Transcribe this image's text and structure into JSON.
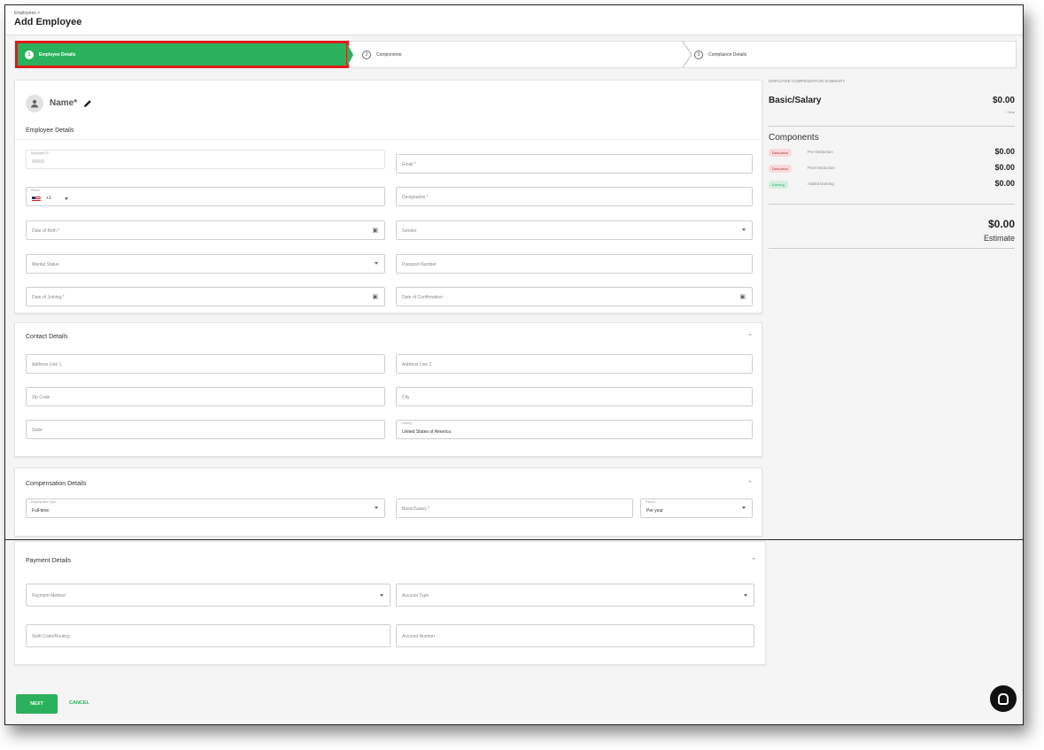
{
  "header": {
    "breadcrumb": "Employees >",
    "title": "Add Employee"
  },
  "stepper": {
    "steps": [
      {
        "number": "1",
        "label": "Employee Details"
      },
      {
        "number": "2",
        "label": "Components"
      },
      {
        "number": "3",
        "label": "Compliance Details"
      }
    ]
  },
  "employee": {
    "name_label": "Name*",
    "section_title": "Employee Details",
    "employee_id": {
      "label": "Employee ID",
      "value": "00000"
    },
    "email": {
      "placeholder": "Email *"
    },
    "phone": {
      "label": "Phone",
      "code": "+1"
    },
    "designation": {
      "placeholder": "Designation *"
    },
    "dob": {
      "placeholder": "Date of Birth *"
    },
    "gender": {
      "placeholder": "Gender"
    },
    "marital": {
      "placeholder": "Marital Status"
    },
    "passport": {
      "placeholder": "Passport Number"
    },
    "joining": {
      "placeholder": "Date of Joining *"
    },
    "confirmation": {
      "placeholder": "Date of Confirmation"
    }
  },
  "contact": {
    "title": "Contact Details",
    "address1": "Address Line 1",
    "address2": "Address Line 2",
    "zip": "Zip Code",
    "city": "City",
    "state": "State",
    "country_label": "Country",
    "country_value": "United States of America"
  },
  "compensation": {
    "title": "Compensation Details",
    "emp_type_label": "Employment Type",
    "emp_type_value": "Full-time",
    "salary": "Basic/Salary *",
    "period_label": "Period *",
    "period_value": "Per year"
  },
  "payment": {
    "title": "Payment Details",
    "method": "Payment Method",
    "account_type": "Account Type",
    "swift": "Swift Code/Routing",
    "account_number": "Account Number"
  },
  "summary": {
    "label": "EMPLOYEE COMPENSATION SUMMARY",
    "basic_label": "Basic/Salary",
    "basic_value": "$0.00",
    "per_year": "/ Year",
    "components_title": "Components",
    "rows": [
      {
        "badge": "Deduction",
        "name": "Pre-Deduction",
        "amount": "$0.00"
      },
      {
        "badge": "Deduction",
        "name": "Post-Deduction",
        "amount": "$0.00"
      },
      {
        "badge": "Earning",
        "name": "Added Earning",
        "amount": "$0.00"
      }
    ],
    "total": "$0.00",
    "estimate": "Estimate"
  },
  "actions": {
    "next": "NEXT",
    "cancel": "CANCEL"
  },
  "colors": {
    "accent": "#2bb15b",
    "highlight": "#e01a1a"
  }
}
